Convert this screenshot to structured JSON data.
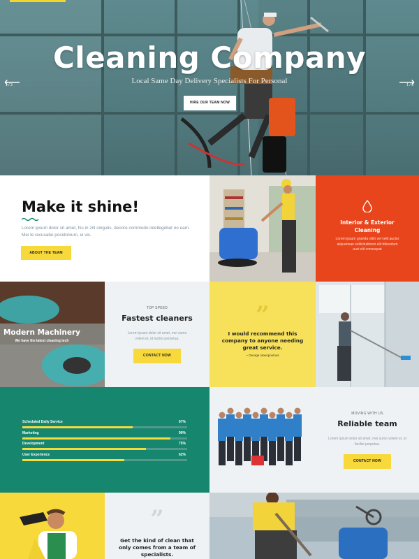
{
  "hero": {
    "title": "Cleaning Company",
    "subtitle": "Local Same Day Delivery Specialists For Personal",
    "button": "HIRE OUR TEAM NOW",
    "slide_left": "1 / 3",
    "slide_right": "1 / 3"
  },
  "shine": {
    "title": "Make it shine!",
    "text": "Lorem ipsum dolor sit amet, his in zril singulis, decore commodo intellegebat no eam. Mei te recusabo posidonium, ei vis.",
    "button": "ABOUT THE TEAM"
  },
  "interior": {
    "title": "Interior & Exterior Cleaning",
    "text": "Lorem ipsum gravida nibh vel velit auctor aliquenean sollicitudinem elit bibendum auci elit consequat"
  },
  "machinery": {
    "title": "Modern Machinery",
    "subtitle": "We have the latest cleaning tech"
  },
  "fastest": {
    "kicker": "TOP SPEED",
    "title": "Fastest cleaners",
    "text": "Lorem ipsum dolor sit amet, mei sumo volent et, id facilisi perpetua.",
    "button": "CONTACT NOW"
  },
  "quote1": {
    "text": "I would recommend this company to anyone needing great service.",
    "author": "~ George Ioanopoulous"
  },
  "skills": [
    {
      "label": "Scheduled Daily Service",
      "pct": "67%",
      "value": 0.67
    },
    {
      "label": "Marketing",
      "pct": "90%",
      "value": 0.9
    },
    {
      "label": "Development",
      "pct": "75%",
      "value": 0.75
    },
    {
      "label": "User Experience",
      "pct": "62%",
      "value": 0.62
    }
  ],
  "reliable": {
    "kicker": "MOVING WITH US",
    "title": "Reliable team",
    "text": "Lorem ipsum dolor sit amet, mei sumo volent et, id facilisi perpetua.",
    "button": "CONTACT NOW"
  },
  "quote2": {
    "text": "Get the kind of clean that only comes from a team of specialists."
  },
  "colors": {
    "yellow": "#f7d93b",
    "orange_red": "#e8451c",
    "teal": "#16866f",
    "light_grey": "#eef2f5"
  }
}
